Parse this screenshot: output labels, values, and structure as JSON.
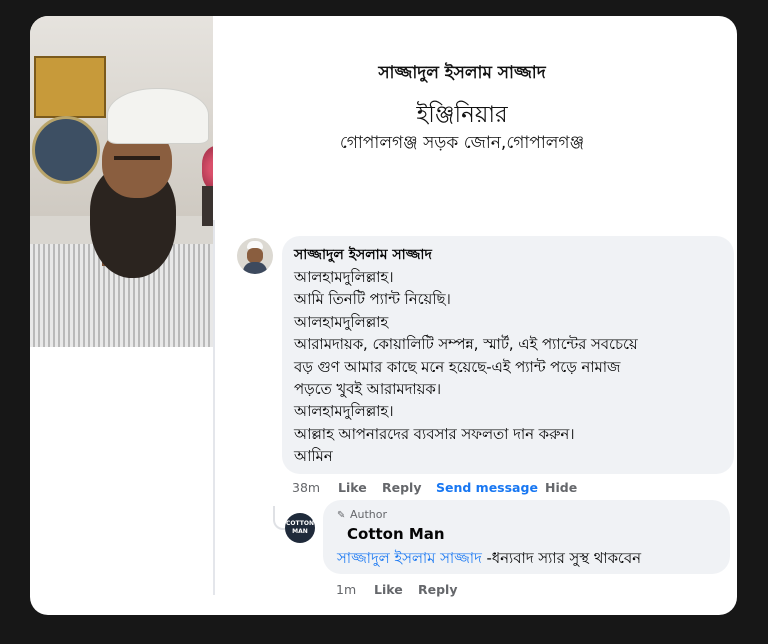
{
  "profile": {
    "name": "সাজ্জাদুল ইসলাম সাজ্জাদ",
    "designation": "ইঞ্জিনিয়ার",
    "office": "গোপালগঞ্জ সড়ক জোন,গোপালগঞ্জ"
  },
  "comment": {
    "author": "সাজ্জাদুল ইসলাম সাজ্জাদ",
    "lines": [
      "আলহামদুলিল্লাহ।",
      "আমি তিনটি প্যান্ট নিয়েছি।",
      "আলহামদুলিল্লাহ",
      "আরামদায়ক, কোয়ালিটি সম্পন্ন, স্মার্ট, এই প্যান্টের সবচেয়ে",
      "বড় গুণ আমার কাছে মনে হয়েছে-এই প্যান্ট পড়ে নামাজ",
      "পড়তে খুবই আরামদায়ক।",
      "আলহামদুলিল্লাহ।",
      "আল্লাহ আপনারদের ব্যবসার সফলতা দান করুন।",
      "আমিন"
    ],
    "time": "38m",
    "like": "Like",
    "reply": "Reply",
    "send_message": "Send message",
    "hide": "Hide"
  },
  "reply": {
    "badge": "Author",
    "author": "Cotton Man",
    "avatar_text": "COTTON MAN",
    "tag": "সাজ্জাদুল ইসলাম সাজ্জাদ",
    "text": " -ধন্যবাদ স্যার সুস্থ থাকবেন",
    "time": "1m",
    "like": "Like",
    "reply": "Reply"
  },
  "colors": {
    "background": "#171717",
    "bubble": "#f0f2f5",
    "link_blue": "#1877f2",
    "meta_gray": "#65676b"
  },
  "icons": [
    "pen-icon"
  ]
}
